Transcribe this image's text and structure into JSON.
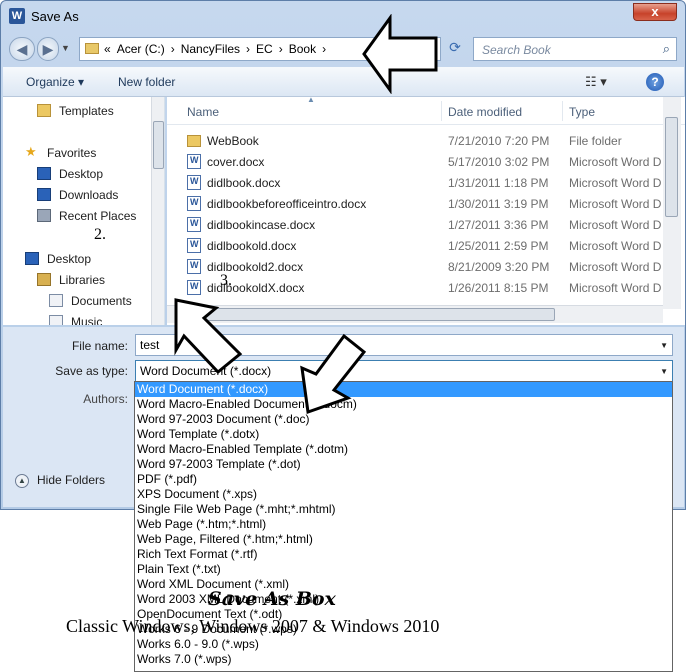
{
  "window": {
    "title": "Save As",
    "app_icon": "word-icon",
    "close_label": "x"
  },
  "address": {
    "crumbs": [
      "«",
      "Acer (C:)",
      "›",
      "NancyFiles",
      "›",
      "EC",
      "›",
      "Book",
      "›"
    ],
    "search_placeholder": "Search Book"
  },
  "toolbar": {
    "organize": "Organize ▾",
    "new_folder": "New folder",
    "views": "☷ ▾",
    "help": "?"
  },
  "nav": {
    "items": [
      {
        "label": "Templates",
        "icon": "folder-icon"
      },
      {
        "label": "Favorites",
        "icon": "star-icon"
      },
      {
        "label": "Desktop",
        "icon": "desktop-icon"
      },
      {
        "label": "Downloads",
        "icon": "downloads-icon"
      },
      {
        "label": "Recent Places",
        "icon": "recent-places-icon"
      },
      {
        "label": "Desktop",
        "icon": "desktop-icon"
      },
      {
        "label": "Libraries",
        "icon": "libraries-icon"
      },
      {
        "label": "Documents",
        "icon": "documents-icon"
      },
      {
        "label": "Music",
        "icon": "music-icon"
      }
    ]
  },
  "files": {
    "columns": [
      "Name",
      "Date modified",
      "Type"
    ],
    "rows": [
      {
        "name": "WebBook",
        "date": "7/21/2010 7:20 PM",
        "type": "File folder",
        "icon": "folder"
      },
      {
        "name": "cover.docx",
        "date": "5/17/2010 3:02 PM",
        "type": "Microsoft Word D",
        "icon": "word"
      },
      {
        "name": "didlbook.docx",
        "date": "1/31/2011 1:18 PM",
        "type": "Microsoft Word D",
        "icon": "word"
      },
      {
        "name": "didlbookbeforeofficeintro.docx",
        "date": "1/30/2011 3:19 PM",
        "type": "Microsoft Word D",
        "icon": "word"
      },
      {
        "name": "didlbookincase.docx",
        "date": "1/27/2011 3:36 PM",
        "type": "Microsoft Word D",
        "icon": "word"
      },
      {
        "name": "didlbookold.docx",
        "date": "1/25/2011 2:59 PM",
        "type": "Microsoft Word D",
        "icon": "word"
      },
      {
        "name": "didlbookold2.docx",
        "date": "8/21/2009 3:20 PM",
        "type": "Microsoft Word D",
        "icon": "word"
      },
      {
        "name": "didlbookoldX.docx",
        "date": "1/26/2011 8:15 PM",
        "type": "Microsoft Word D",
        "icon": "word"
      }
    ]
  },
  "form": {
    "filename_label": "File name:",
    "filename_value": "test",
    "savetype_label": "Save as type:",
    "savetype_value": "Word Document (*.docx)",
    "authors_label": "Authors:",
    "hide_folders": "Hide Folders"
  },
  "type_options": [
    "Word Document (*.docx)",
    "Word Macro-Enabled Document (*.docm)",
    "Word 97-2003 Document (*.doc)",
    "Word Template (*.dotx)",
    "Word Macro-Enabled Template (*.dotm)",
    "Word 97-2003 Template (*.dot)",
    "PDF (*.pdf)",
    "XPS Document (*.xps)",
    "Single File Web Page (*.mht;*.mhtml)",
    "Web Page (*.htm;*.html)",
    "Web Page, Filtered (*.htm;*.html)",
    "Rich Text Format (*.rtf)",
    "Plain Text (*.txt)",
    "Word XML Document (*.xml)",
    "Word 2003 XML Document (*.xml)",
    "OpenDocument Text (*.odt)",
    "Works 6 - 9 Document (*.wps)",
    "Works 6.0 - 9.0 (*.wps)",
    "Works 7.0 (*.wps)"
  ],
  "annotations": {
    "caption_title": "Save As Box",
    "caption_sub": "Classic Windows, Windows 2007 & Windows 2010",
    "marker_2": "2.",
    "marker_3": "3."
  }
}
